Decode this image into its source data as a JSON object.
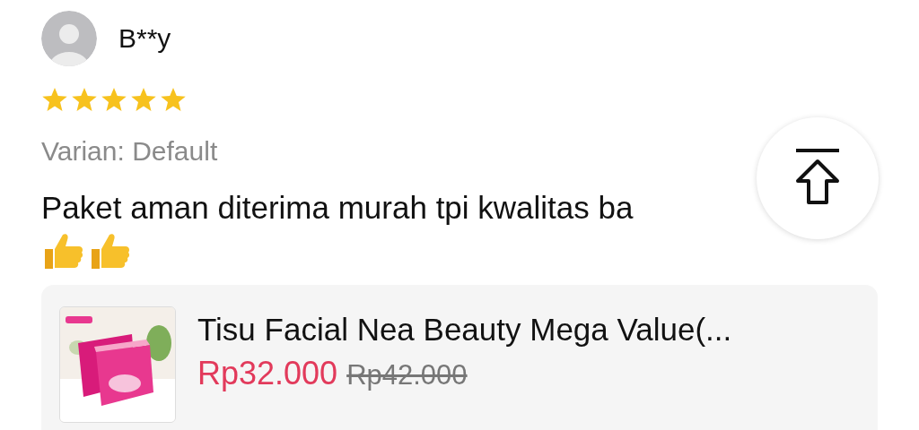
{
  "review": {
    "reviewer": "B**y",
    "stars": 5,
    "variant": "Varian: Default",
    "text": "Paket aman diterima murah tpi kwalitas ba"
  },
  "product": {
    "kind": "picture",
    "title": "Tisu Facial Nea Beauty Mega Value(...",
    "price": "Rp32.000",
    "original_price": "Rp42.000"
  }
}
